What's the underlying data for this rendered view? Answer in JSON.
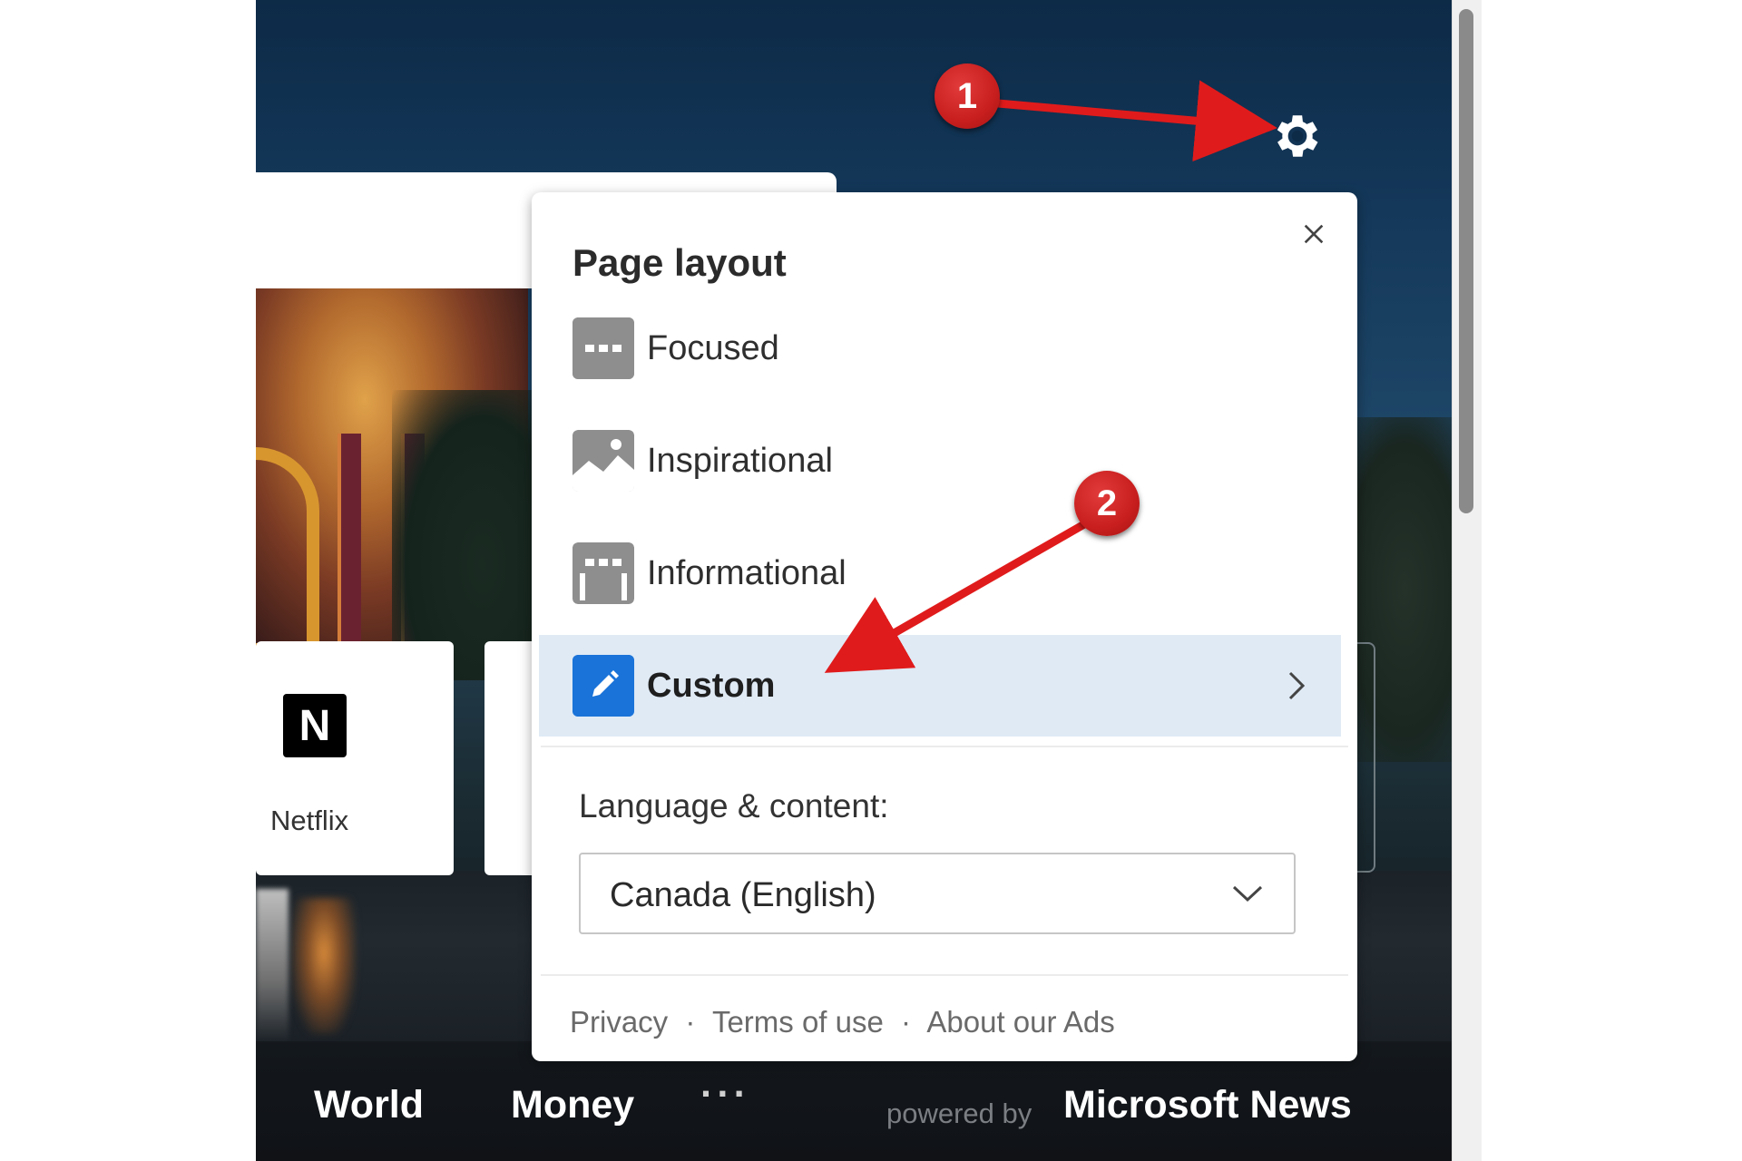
{
  "bottom_nav": {
    "items": [
      "World",
      "Money"
    ],
    "more": "···",
    "powered_by": "powered by",
    "brand": "Microsoft News"
  },
  "quick_links": [
    {
      "name": "Netflix",
      "logo_letter": "N"
    }
  ],
  "panel": {
    "title": "Page layout",
    "options": [
      {
        "label": "Focused",
        "icon": "focused-layout-icon"
      },
      {
        "label": "Inspirational",
        "icon": "inspirational-layout-icon"
      },
      {
        "label": "Informational",
        "icon": "informational-layout-icon"
      },
      {
        "label": "Custom",
        "icon": "pencil-icon",
        "selected": true
      }
    ],
    "language_label": "Language & content:",
    "language_value": "Canada (English)",
    "footer": {
      "privacy": "Privacy",
      "terms": "Terms of use",
      "ads": "About our Ads",
      "separator": "·"
    }
  },
  "annotations": {
    "badge_1": "1",
    "badge_2": "2",
    "color": "#d01f1f"
  },
  "colors": {
    "custom_highlight": "#dfeaf5",
    "custom_icon": "#1a73d9"
  }
}
